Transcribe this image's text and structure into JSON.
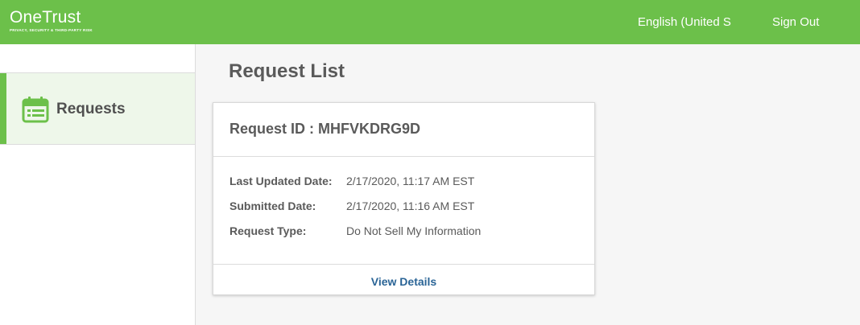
{
  "header": {
    "logo_name": "OneTrust",
    "logo_tagline": "PRIVACY, SECURITY & THIRD-PARTY RISK",
    "language": "English (United States)",
    "sign_out": "Sign Out"
  },
  "sidebar": {
    "items": [
      {
        "label": "Requests",
        "icon": "calendar-icon",
        "active": true
      }
    ]
  },
  "main": {
    "title": "Request List",
    "request": {
      "id_label": "Request ID : MHFVKDRG9D",
      "fields": [
        {
          "label": "Last Updated Date:",
          "value": "2/17/2020, 11:17 AM EST"
        },
        {
          "label": "Submitted Date:",
          "value": "2/17/2020, 11:16 AM EST"
        },
        {
          "label": "Request Type:",
          "value": "Do Not Sell My Information"
        }
      ],
      "view_details": "View Details"
    }
  },
  "colors": {
    "brand_green": "#6cc04a",
    "active_bg": "#eef7ea",
    "link_blue": "#2a6496",
    "text_gray": "#5a5a5a"
  }
}
